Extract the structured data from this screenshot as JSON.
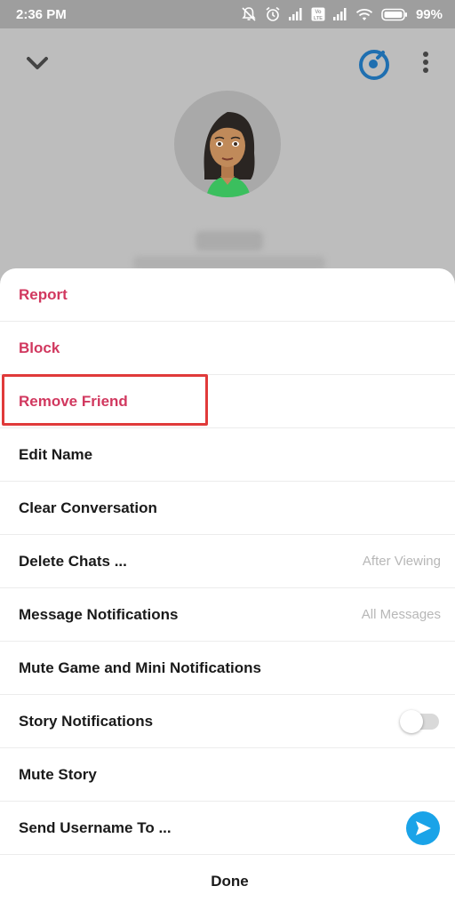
{
  "status_bar": {
    "time": "2:36 PM",
    "battery": "99%",
    "volte": "Vo LTE",
    "icons": [
      "mute-icon",
      "alarm-icon",
      "signal-icon",
      "volte-icon",
      "signal-icon",
      "wifi-icon",
      "battery-icon"
    ]
  },
  "header": {
    "back_icon": "chevron-down-icon",
    "bitmoji_icon": "bitmoji-icon",
    "menu_icon": "more-vertical-icon"
  },
  "menu": {
    "report": "Report",
    "block": "Block",
    "remove_friend": "Remove Friend",
    "edit_name": "Edit Name",
    "clear_conversation": "Clear Conversation",
    "delete_chats": "Delete Chats ...",
    "delete_chats_value": "After Viewing",
    "message_notifications": "Message Notifications",
    "message_notifications_value": "All Messages",
    "mute_game": "Mute Game and Mini Notifications",
    "story_notifications": "Story Notifications",
    "story_notifications_on": false,
    "mute_story": "Mute Story",
    "send_username": "Send Username To ...",
    "done": "Done"
  },
  "colors": {
    "destructive": "#d1385f",
    "highlight": "#e03a3a",
    "accent": "#1aa3e8"
  }
}
